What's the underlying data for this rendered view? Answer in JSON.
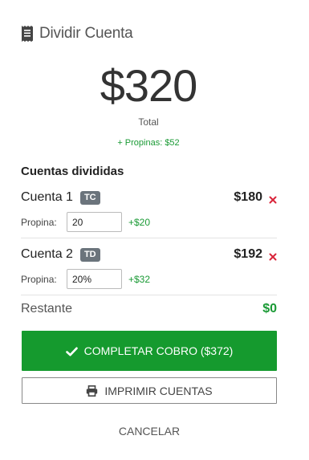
{
  "header": {
    "icon": "receipt-icon",
    "title": "Dividir Cuenta"
  },
  "summary": {
    "total_amount": "$320",
    "total_label": "Total",
    "tips_text": "+ Propinas: $52"
  },
  "splits_section": {
    "title": "Cuentas divididas"
  },
  "splits": [
    {
      "name": "Cuenta 1",
      "method": "TC",
      "amount": "$180",
      "tip_label": "Propina:",
      "tip_value": "20",
      "tip_amount": "+$20"
    },
    {
      "name": "Cuenta 2",
      "method": "TD",
      "amount": "$192",
      "tip_label": "Propina:",
      "tip_value": "20%",
      "tip_amount": "+$32"
    }
  ],
  "remaining": {
    "label": "Restante",
    "amount": "$0"
  },
  "actions": {
    "complete_label": "COMPLETAR COBRO ($372)",
    "complete_icon": "check-icon",
    "print_label": "IMPRIMIR CUENTAS",
    "print_icon": "printer-icon",
    "cancel_label": "CANCELAR"
  },
  "colors": {
    "accent_green": "#159a2e",
    "remove_red": "#d9253a",
    "badge_gray": "#6b747c"
  }
}
